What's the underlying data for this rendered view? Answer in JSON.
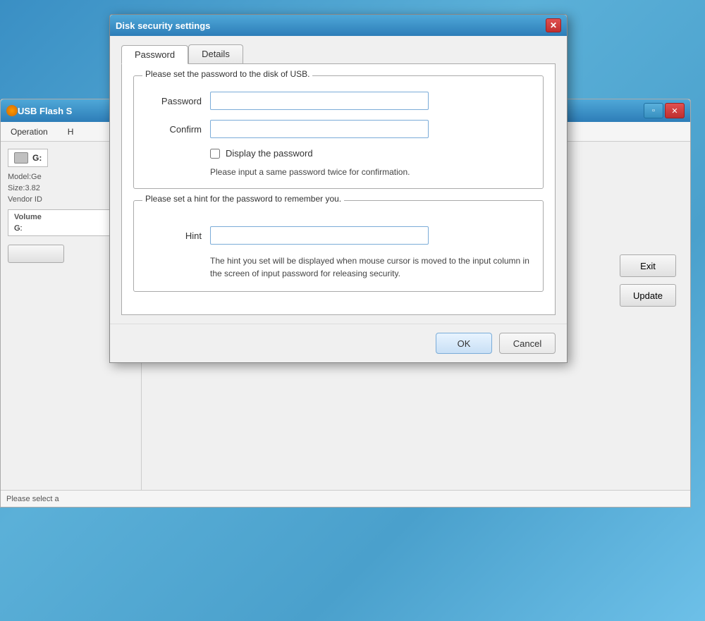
{
  "background": {
    "title": "USB Flash S",
    "icon": "usb-icon",
    "menu": [
      "Operation",
      "H"
    ],
    "controls": [
      "minimize",
      "close"
    ],
    "driveLabel": "G:",
    "driveInfo": {
      "model": "Model:Ge",
      "size": "Size:3.82",
      "vendor": "Vendor ID"
    },
    "volumeHeader": "Volume",
    "volumeDrive": "G:",
    "buttons": {
      "exit": "Exit",
      "update": "Update"
    },
    "statusBar": "Please select a"
  },
  "dialog": {
    "title": "Disk security settings",
    "tabs": [
      "Password",
      "Details"
    ],
    "activeTab": "Password",
    "passwordGroup": {
      "legend": "Please set the password to the disk of USB.",
      "passwordLabel": "Password",
      "passwordPlaceholder": "",
      "confirmLabel": "Confirm",
      "confirmPlaceholder": "",
      "displayCheckboxLabel": "Display the password",
      "hintText": "Please input a same password twice for confirmation."
    },
    "hintGroup": {
      "legend": "Please set a hint for the password to remember you.",
      "hintLabel": "Hint",
      "hintPlaceholder": "",
      "hintDescription": "The hint you set will be displayed when mouse cursor is moved to the input column in the screen of input password for releasing security."
    },
    "footer": {
      "okLabel": "OK",
      "cancelLabel": "Cancel"
    }
  }
}
